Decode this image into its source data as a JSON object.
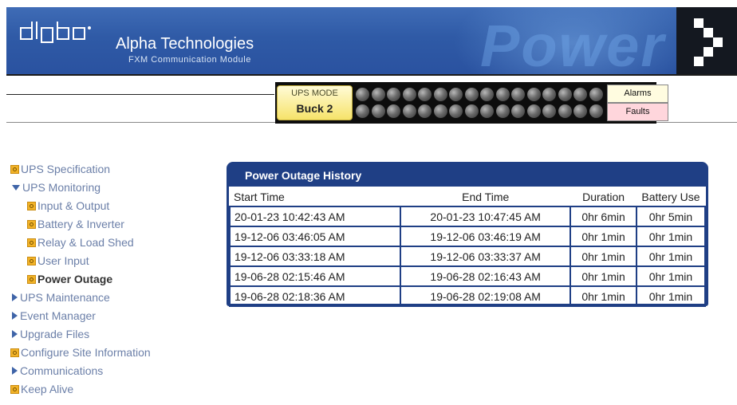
{
  "header": {
    "company": "Alpha Technologies",
    "module": "FXM Communication Module",
    "watermark": "Power",
    "colors": {
      "banner": "#2f5aa6",
      "panel": "#1f3f85"
    }
  },
  "status": {
    "mode_label": "UPS MODE",
    "mode_value": "Buck 2",
    "alarms_label": "Alarms",
    "faults_label": "Faults"
  },
  "sidebar": {
    "items": [
      {
        "label": "UPS Specification",
        "icon": "doc-icon"
      },
      {
        "label": "UPS Monitoring",
        "icon": "expanded-arrow-icon"
      },
      {
        "label": "Input & Output",
        "icon": "doc-icon"
      },
      {
        "label": "Battery & Inverter",
        "icon": "doc-icon"
      },
      {
        "label": "Relay & Load Shed",
        "icon": "doc-icon"
      },
      {
        "label": "User Input",
        "icon": "doc-icon"
      },
      {
        "label": "Power Outage",
        "icon": "doc-icon"
      },
      {
        "label": "UPS Maintenance",
        "icon": "collapsed-arrow-icon"
      },
      {
        "label": "Event Manager",
        "icon": "collapsed-arrow-icon"
      },
      {
        "label": "Upgrade Files",
        "icon": "collapsed-arrow-icon"
      },
      {
        "label": "Configure Site Information",
        "icon": "doc-icon"
      },
      {
        "label": "Communications",
        "icon": "collapsed-arrow-icon"
      },
      {
        "label": "Keep Alive",
        "icon": "doc-icon"
      }
    ]
  },
  "panel": {
    "title": "Power Outage History",
    "columns": [
      "Start Time",
      "End Time",
      "Duration",
      "Battery Use"
    ],
    "rows": [
      [
        "20-01-23 10:42:43 AM",
        "20-01-23 10:47:45 AM",
        "0hr 6min",
        "0hr 5min"
      ],
      [
        "19-12-06 03:46:05 AM",
        "19-12-06 03:46:19 AM",
        "0hr 1min",
        "0hr 1min"
      ],
      [
        "19-12-06 03:33:18 AM",
        "19-12-06 03:33:37 AM",
        "0hr 1min",
        "0hr 1min"
      ],
      [
        "19-06-28 02:15:46 AM",
        "19-06-28 02:16:43 AM",
        "0hr 1min",
        "0hr 1min"
      ],
      [
        "19-06-28 02:18:36 AM",
        "19-06-28 02:19:08 AM",
        "0hr 1min",
        "0hr 1min"
      ]
    ]
  }
}
